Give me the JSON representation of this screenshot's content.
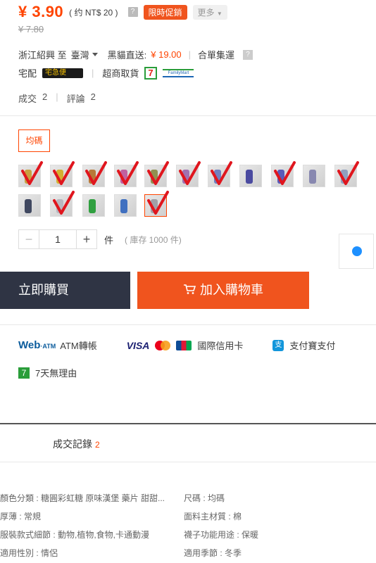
{
  "price": {
    "current": "¥ 3.90",
    "converted": "( 约 NT$ 20 )",
    "help": "?",
    "promo_label": "限時促銷",
    "more_label": "更多",
    "original": "¥ 7.80"
  },
  "shipping": {
    "from": "浙江紹興 至",
    "to": "臺灣",
    "method": "黑貓直送:",
    "fee": "¥ 19.00",
    "consolidation": "合單集運",
    "help": "?"
  },
  "delivery": {
    "home": "宅配",
    "yamato_logo": "宅急便",
    "store_pickup": "超商取貨",
    "seven_logo": "7",
    "family_logo": "FamilyMart"
  },
  "stats": {
    "sold_label": "成交",
    "sold_count": "2",
    "reviews_label": "評論",
    "reviews_count": "2"
  },
  "size_option": "均碼",
  "variants": [
    {
      "color": "#c8a040"
    },
    {
      "color": "#d4b030"
    },
    {
      "color": "#b87838"
    },
    {
      "color": "#c060a0"
    },
    {
      "color": "#909050"
    },
    {
      "color": "#a070b0"
    },
    {
      "color": "#7080c0"
    },
    {
      "color": "#4a4aa0"
    },
    {
      "color": "#5a5ab8"
    },
    {
      "color": "#8888b0"
    },
    {
      "color": "#90a0c0"
    },
    {
      "color": "#404860"
    },
    {
      "color": "#b8b8c0"
    },
    {
      "color": "#30a040"
    },
    {
      "color": "#4070c0"
    },
    {
      "color": "#a0a0a8"
    }
  ],
  "quantity": {
    "minus": "−",
    "value": "1",
    "plus": "+",
    "unit": "件",
    "stock": "( 庫存 1000 件)"
  },
  "actions": {
    "buy_now": "立即購買",
    "add_to_cart": "加入購物車"
  },
  "payment": {
    "webatm": "Web",
    "webatm_small": "·ATM",
    "atm_transfer": "ATM轉帳",
    "visa": "VISA",
    "intl_card": "國際信用卡",
    "alipay_icon": "支",
    "alipay": "支付寶支付"
  },
  "returns": {
    "icon": "7",
    "label": "7天無理由"
  },
  "records": {
    "label": "成交記錄",
    "count": "2"
  },
  "attributes": [
    {
      "text": "顏色分類 : 糖圓彩虹糖 原味漢堡 藥片 甜甜..."
    },
    {
      "text": "尺碼 : 均碼"
    },
    {
      "text": "厚薄 : 常規"
    },
    {
      "text": "面料主材質 : 棉"
    },
    {
      "text": "服裝款式細節 : 動物,植物,食物,卡通動漫"
    },
    {
      "text": "襪子功能用途 : 保暖"
    },
    {
      "text": "適用性別 : 情侶"
    },
    {
      "text": "適用季節 : 冬季"
    }
  ],
  "colors": {
    "accent": "#ff4400",
    "promo": "#f0541e",
    "buy_now_bg": "#2f3444"
  }
}
